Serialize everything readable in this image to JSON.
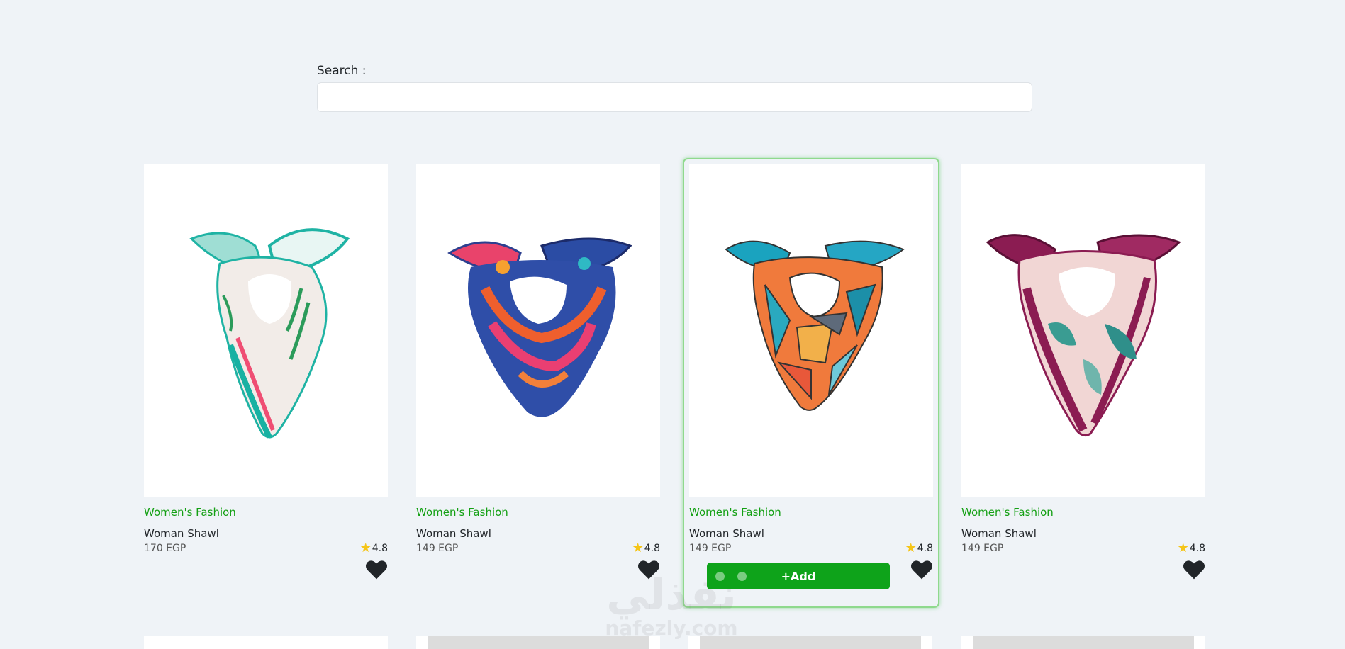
{
  "search": {
    "label": "Search :",
    "value": "",
    "placeholder": ""
  },
  "products": [
    {
      "category": "Women's Fashion",
      "title": "Woman Shawl",
      "price": "170 EGP",
      "rating": "4.8",
      "icon": "star-icon",
      "favorite_icon": "heart-icon"
    },
    {
      "category": "Women's Fashion",
      "title": "Woman Shawl",
      "price": "149 EGP",
      "rating": "4.8",
      "icon": "star-icon",
      "favorite_icon": "heart-icon"
    },
    {
      "category": "Women's Fashion",
      "title": "Woman Shawl",
      "price": "149 EGP",
      "rating": "4.8",
      "icon": "star-icon",
      "favorite_icon": "heart-icon",
      "add_label": "+Add"
    },
    {
      "category": "Women's Fashion",
      "title": "Woman Shawl",
      "price": "149 EGP",
      "rating": "4.8",
      "icon": "star-icon",
      "favorite_icon": "heart-icon"
    }
  ],
  "watermark": {
    "arabic": "نفذلي",
    "latin": "nafezly.com"
  },
  "colors": {
    "background": "#eff3f7",
    "category_text": "#14a014",
    "add_button": "#0ea31a",
    "star": "#f5c518",
    "hover_border": "#8fd98d"
  }
}
